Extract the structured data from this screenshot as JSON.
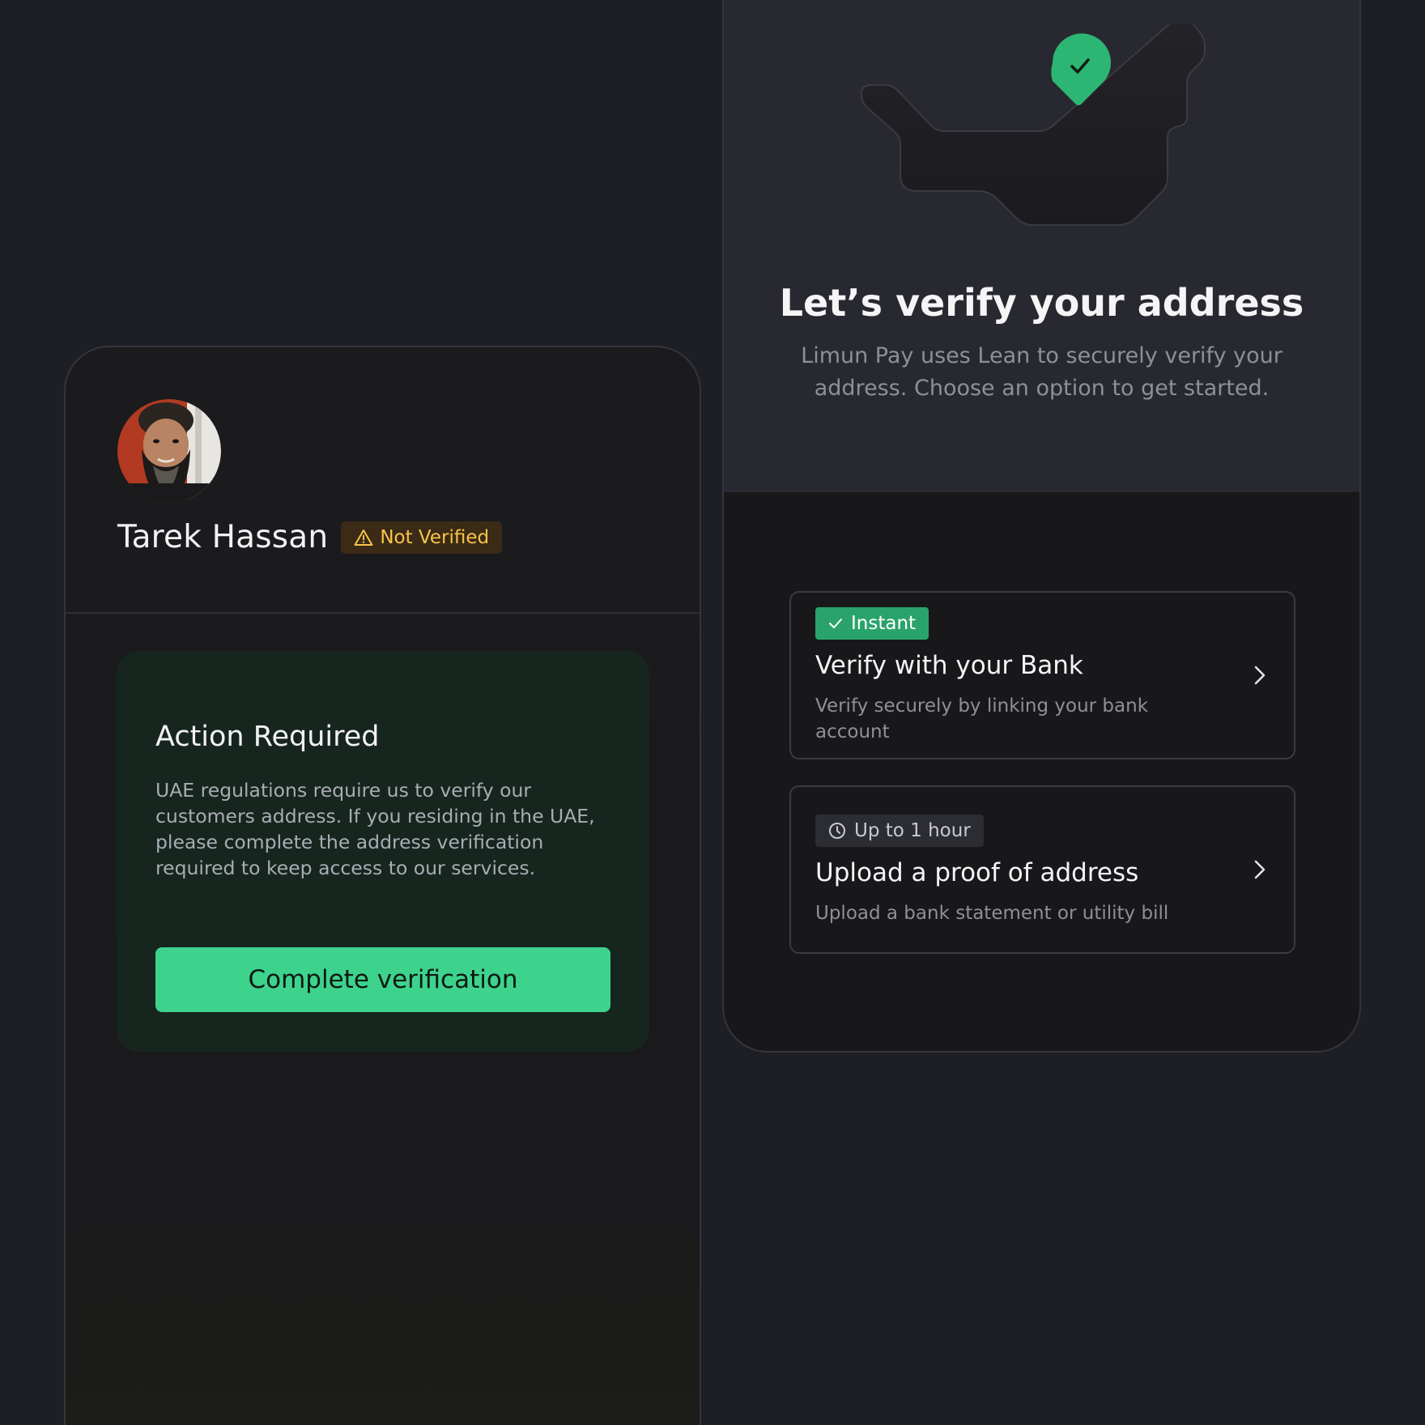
{
  "profile": {
    "name": "Tarek Hassan",
    "status_badge": "Not Verified"
  },
  "action_card": {
    "title": "Action Required",
    "body": "UAE regulations require us to verify our customers address. If you residing in the UAE, please complete the address verification required to keep access to our services.",
    "button_label": "Complete verification"
  },
  "verify_screen": {
    "title": "Let’s verify your address",
    "subtitle": "Limun Pay uses Lean to securely verify your address. Choose an option to get started.",
    "options": [
      {
        "badge": "Instant",
        "title": "Verify with your Bank",
        "description": "Verify securely by linking your bank account"
      },
      {
        "badge": "Up to 1 hour",
        "title": "Upload a proof of address",
        "description": "Upload a bank statement or utility bill"
      }
    ]
  },
  "colors": {
    "background": "#1d1f24",
    "accent_green": "#3dd38d",
    "warning_yellow": "#f7c548",
    "instant_badge": "#2aa36b"
  },
  "icons": {
    "warning": "warning-triangle-icon",
    "check": "checkmark-icon",
    "clock": "clock-icon",
    "chevron": "chevron-right-icon",
    "pin": "location-pin-check-icon"
  }
}
